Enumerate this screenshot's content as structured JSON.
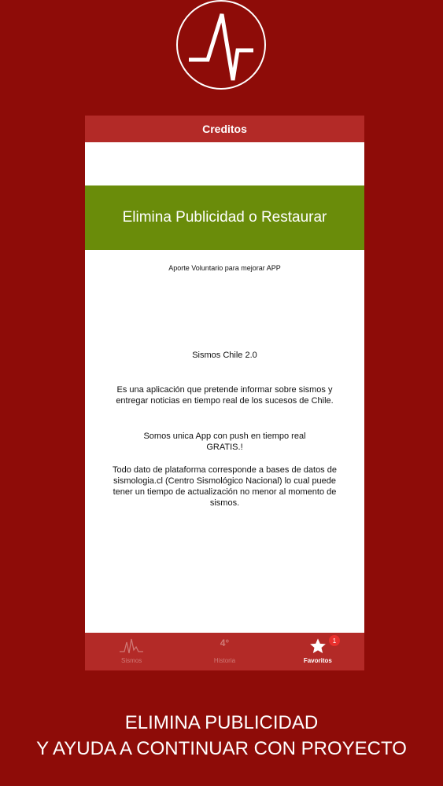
{
  "logo": {
    "icon": "seismograph-pulse-icon"
  },
  "screen": {
    "nav_title": "Creditos",
    "remove_ads_label": "Elimina Publicidad o Restaurar",
    "contribution_text": "Aporte Voluntario para mejorar APP",
    "app_name": "Sismos Chile 2.0",
    "paragraph_1": "Es una aplicación que pretende informar sobre sismos y entregar noticias en tiempo real de los sucesos de Chile.",
    "paragraph_2": "Somos unica App con push en tiempo real GRATIS.!",
    "paragraph_3": "Todo dato de plataforma corresponde a bases de datos de sismologia.cl (Centro Sismológico Nacional) lo cual puede tener un tiempo de actualización no menor al momento de sismos."
  },
  "tabs": [
    {
      "label": "Sismos",
      "icon": "seismograph-icon",
      "active": false
    },
    {
      "label": "Historia",
      "icon_text": "4°",
      "icon": "history-icon",
      "active": false
    },
    {
      "label": "Favoritos",
      "icon": "star-icon",
      "active": true,
      "badge": "1"
    }
  ],
  "tagline": {
    "line1": "ELIMINA PUBLICIDAD",
    "line2": "Y AYUDA A CONTINUAR CON PROYECTO"
  },
  "colors": {
    "background": "#8e0c08",
    "navbar": "#b32a27",
    "button_green": "#6a8c0a",
    "badge": "#e8302d"
  }
}
